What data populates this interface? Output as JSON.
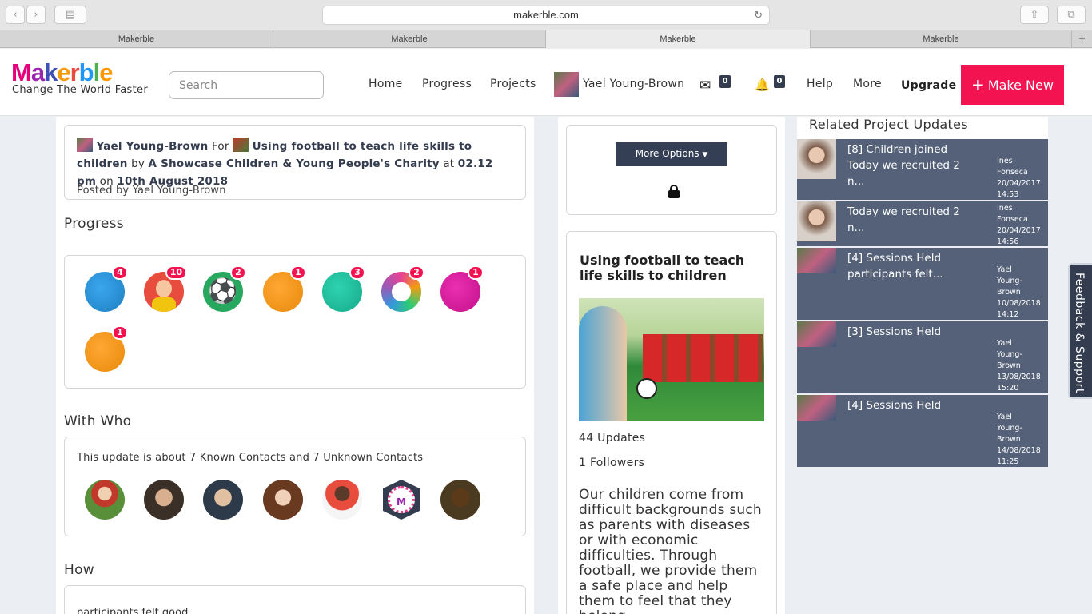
{
  "browser": {
    "url": "makerble.com",
    "tabs": [
      "Makerble",
      "Makerble",
      "Makerble",
      "Makerble"
    ],
    "new_tab": "+"
  },
  "header": {
    "logo": "Makerble",
    "tagline": "Change The World Faster",
    "search_placeholder": "Search",
    "nav": {
      "home": "Home",
      "progress": "Progress",
      "projects": "Projects",
      "user": "Yael Young-Brown",
      "messages_count": "0",
      "notifications_count": "0",
      "help": "Help",
      "more": "More",
      "upgrade": "Upgrade",
      "make_new": "Make New"
    }
  },
  "post": {
    "author": "Yael Young-Brown",
    "for_word": "For",
    "project": "Using football to teach life skills to children",
    "by_word": "by",
    "org": "A Showcase Children & Young People's Charity",
    "at_word": "at",
    "time": "02.12 pm",
    "on_word": "on",
    "date": "10th August 2018",
    "posted_by": "Posted by Yael Young-Brown"
  },
  "progress": {
    "title": "Progress",
    "items": [
      {
        "color": "#1f8fd6",
        "count": "4"
      },
      {
        "color": "#e74c3c",
        "count": "10"
      },
      {
        "color": "#27a85f",
        "count": "2"
      },
      {
        "color": "#f39c12",
        "count": "1"
      },
      {
        "color": "#1abc9c",
        "count": "3"
      },
      {
        "color": "#e84393",
        "count": "2"
      },
      {
        "color": "#d81b9c",
        "count": "1"
      },
      {
        "color": "#f39c12",
        "count": "1"
      }
    ]
  },
  "with_who": {
    "title": "With Who",
    "summary": "This update is about 7 Known Contacts and 7 Unknown Contacts",
    "avatars": [
      "#5a8f3a",
      "#4a4035",
      "#3b4a5a",
      "#5a3a28",
      "#c0392b",
      "#ffffff",
      "#4a3a20"
    ]
  },
  "how": {
    "title": "How",
    "text": "participants felt good"
  },
  "options": {
    "more_options": "More Options"
  },
  "project_card": {
    "title": "Using football to teach life skills to children",
    "updates": "44 Updates",
    "followers": "1 Followers",
    "description": "Our children come from difficult backgrounds such as parents with diseases or with economic difficulties. Through football, we provide them a safe place and help them to feel that they belong."
  },
  "related": {
    "title": "Related Project Updates",
    "items": [
      {
        "title": "[8] Children joined Today we recruited 2 n...",
        "meta": [
          "Ines",
          "Fonseca",
          "20/04/2017",
          "14:53"
        ]
      },
      {
        "title": "Today we recruited 2 n...",
        "meta": [
          "Ines",
          "Fonseca",
          "20/04/2017",
          "14:56"
        ]
      },
      {
        "title": "[4] Sessions Held participants felt...",
        "meta": [
          "Yael",
          "Young-",
          "Brown",
          "10/08/2018",
          "14:12"
        ]
      },
      {
        "title": "[3] Sessions Held",
        "meta": [
          "Yael",
          "Young-",
          "Brown",
          "13/08/2018",
          "15:20"
        ]
      },
      {
        "title": "[4] Sessions Held",
        "meta": [
          "Yael",
          "Young-",
          "Brown",
          "14/08/2018",
          "11:25"
        ]
      }
    ]
  },
  "feedback": "Feedback & Support"
}
